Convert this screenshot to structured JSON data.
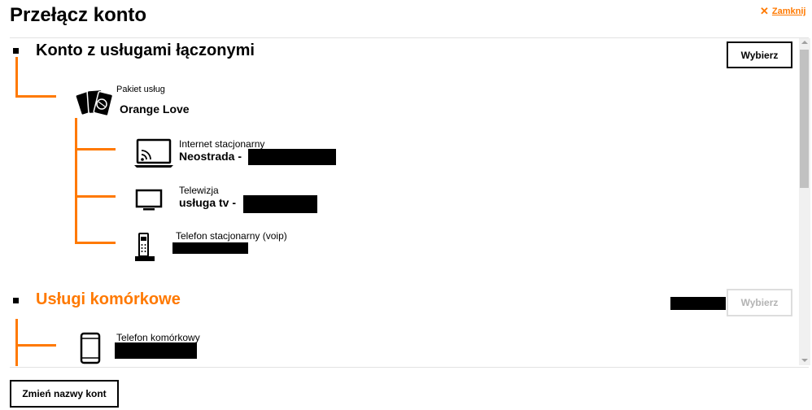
{
  "dialog": {
    "title": "Przełącz konto",
    "close_label": "Zamknij"
  },
  "sections": [
    {
      "title": "Konto z usługami łączonymi",
      "button_label": "Wybierz",
      "package": {
        "label": "Pakiet usług",
        "name": "Orange Love",
        "icon": "cards-icon",
        "services": [
          {
            "label": "Internet stacjonarny",
            "name": "Neostrada -",
            "icon": "laptop-icon"
          },
          {
            "label": "Telewizja",
            "name": "usługa tv -",
            "icon": "tv-icon"
          },
          {
            "label": "Telefon stacjonarny (voip)",
            "name": "",
            "icon": "cordless-phone-icon"
          }
        ]
      }
    },
    {
      "title": "Usługi komórkowe",
      "button_label": "Wybierz",
      "title_color": "#ff7900",
      "services": [
        {
          "label": "Telefon komórkowy",
          "name": "",
          "icon": "mobile-phone-icon"
        }
      ]
    }
  ],
  "footer": {
    "rename_button_label": "Zmień nazwy kont"
  },
  "colors": {
    "accent": "#ff7900",
    "text": "#000000",
    "disabled": "#b3b3b3"
  }
}
